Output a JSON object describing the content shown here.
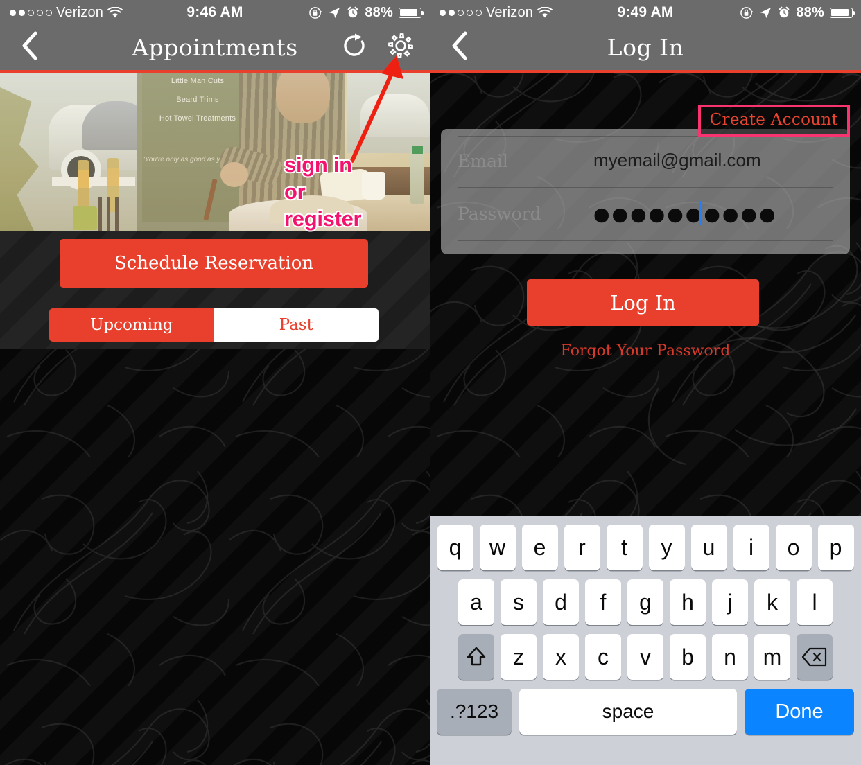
{
  "left": {
    "status": {
      "carrier": "Verizon",
      "signal_filled": 2,
      "signal_total": 5,
      "time": "9:46 AM",
      "battery_pct": "88%",
      "icons": [
        "rotation-lock-icon",
        "location-arrow-icon",
        "alarm-clock-icon",
        "battery-icon"
      ]
    },
    "nav": {
      "back_icon": "chevron-left-icon",
      "title": "Appointments",
      "refresh_icon": "refresh-icon",
      "settings_icon": "gear-icon"
    },
    "photo": {
      "alt": "barber shaving a client in a barbershop window",
      "sign_lines": [
        "Little Man Cuts",
        "Beard Trims",
        "Hot Towel Treatments"
      ],
      "sign_quote": "\"You're only as good as your last ...\""
    },
    "annotation": {
      "lines": [
        "sign in",
        "or",
        "register"
      ],
      "text_color": "#f3136f",
      "outline_color": "#ffffff",
      "arrow_color": "#ee2012"
    },
    "schedule_button": "Schedule Reservation",
    "segments": [
      {
        "label": "Upcoming",
        "selected": true
      },
      {
        "label": "Past",
        "selected": false
      }
    ]
  },
  "right": {
    "status": {
      "carrier": "Verizon",
      "signal_filled": 2,
      "signal_total": 5,
      "time": "9:49 AM",
      "battery_pct": "88%"
    },
    "nav": {
      "back_icon": "chevron-left-icon",
      "title": "Log In"
    },
    "create_account": "Create Account",
    "create_account_highlight_color": "#f8336f",
    "form": {
      "email": {
        "label": "Email",
        "value": "myemail@gmail.com",
        "placeholder": "Email"
      },
      "password": {
        "label": "Password",
        "value": "●●●●●●●●●●",
        "placeholder": "Password",
        "caret_visible": true
      }
    },
    "login_button": "Log In",
    "forgot_link": "Forgot Your Password",
    "keyboard": {
      "row1": [
        "q",
        "w",
        "e",
        "r",
        "t",
        "y",
        "u",
        "i",
        "o",
        "p"
      ],
      "row2": [
        "a",
        "s",
        "d",
        "f",
        "g",
        "h",
        "j",
        "k",
        "l"
      ],
      "row3": [
        "z",
        "x",
        "c",
        "v",
        "b",
        "n",
        "m"
      ],
      "shift_icon": "shift-arrow-icon",
      "delete_icon": "backspace-icon",
      "numbers_key": ".?123",
      "space_key": "space",
      "done_key": "Done",
      "done_color": "#0a84ff"
    }
  },
  "theme": {
    "accent_red": "#e8402c",
    "nav_gray": "#6b6b6b",
    "background_dark": "#070707",
    "highlight_pink": "#f8336f",
    "keyboard_bg": "#cdd0d6"
  }
}
